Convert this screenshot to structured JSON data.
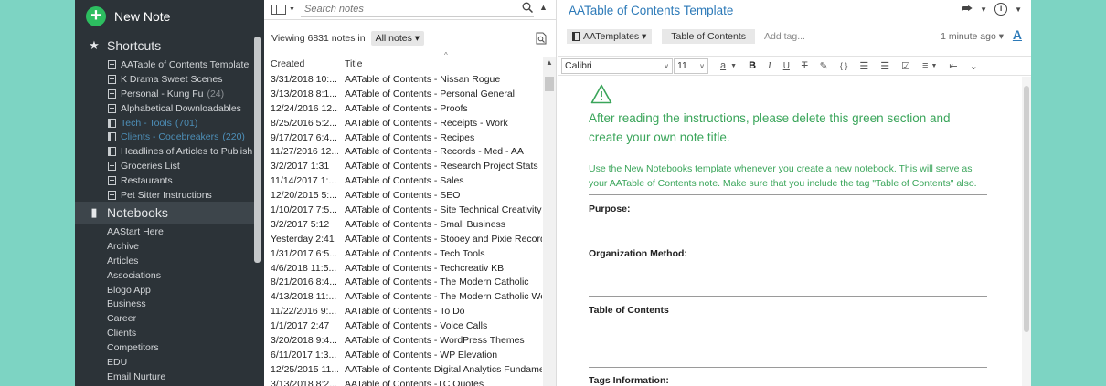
{
  "sidebar": {
    "new_note": "New Note",
    "shortcuts_label": "Shortcuts",
    "notebooks_label": "Notebooks",
    "shortcuts": [
      {
        "label": "AATable of Contents Template",
        "type": "note",
        "count": "",
        "dim": false
      },
      {
        "label": "K Drama Sweet Scenes",
        "type": "note",
        "count": "",
        "dim": false
      },
      {
        "label": "Personal - Kung Fu",
        "type": "note",
        "count": "(24)",
        "dim": false
      },
      {
        "label": "Alphabetical Downloadables",
        "type": "note",
        "count": "",
        "dim": false
      },
      {
        "label": "Tech - Tools",
        "type": "notebook",
        "count": "(701)",
        "dim": true
      },
      {
        "label": "Clients - Codebreakers",
        "type": "notebook",
        "count": "(220)",
        "dim": true
      },
      {
        "label": "Headlines of Articles to Publish",
        "type": "notebook",
        "count": "",
        "dim": false
      },
      {
        "label": "Groceries List",
        "type": "note",
        "count": "",
        "dim": false
      },
      {
        "label": "Restaurants",
        "type": "note",
        "count": "",
        "dim": false
      },
      {
        "label": "Pet Sitter Instructions",
        "type": "note",
        "count": "",
        "dim": false
      }
    ],
    "notebooks": [
      "AAStart Here",
      "Archive",
      "Articles",
      "Associations",
      "Blogo App",
      "Business",
      "Career",
      "Clients",
      "Competitors",
      "EDU",
      "Email Nurture"
    ]
  },
  "note_list": {
    "search_placeholder": "Search notes",
    "viewing_text": "Viewing 6831 notes in",
    "filter_label": "All notes ▾",
    "col_created": "Created",
    "col_title": "Title",
    "rows": [
      {
        "created": "3/31/2018 10:...",
        "title": "AATable of Contents - Nissan Rogue"
      },
      {
        "created": "3/13/2018 8:1...",
        "title": "AATable of Contents - Personal General"
      },
      {
        "created": "12/24/2016 12...",
        "title": "AATable of Contents - Proofs"
      },
      {
        "created": "8/25/2016 5:2...",
        "title": "AATable of Contents - Receipts - Work"
      },
      {
        "created": "9/17/2017 6:4...",
        "title": "AATable of Contents - Recipes"
      },
      {
        "created": "11/27/2016 12...",
        "title": "AATable of Contents - Records - Med - AA"
      },
      {
        "created": "3/2/2017 1:31",
        "title": "AATable of Contents - Research Project Stats"
      },
      {
        "created": "11/14/2017 1:...",
        "title": "AATable of Contents - Sales"
      },
      {
        "created": "12/20/2015 5:...",
        "title": "AATable of Contents - SEO"
      },
      {
        "created": "1/10/2017 7:5...",
        "title": "AATable of Contents - Site Technical Creativity"
      },
      {
        "created": "3/2/2017 5:12",
        "title": "AATable of Contents - Small Business"
      },
      {
        "created": "Yesterday 2:41",
        "title": "AATable of Contents - Stooey and Pixie Records"
      },
      {
        "created": "1/31/2017 6:5...",
        "title": "AATable of Contents - Tech Tools"
      },
      {
        "created": "4/6/2018 11:5...",
        "title": "AATable of Contents - Techcreativ KB"
      },
      {
        "created": "8/21/2016 8:4...",
        "title": "AATable of Contents - The Modern Catholic"
      },
      {
        "created": "4/13/2018 11:...",
        "title": "AATable of Contents - The Modern Catholic Web..."
      },
      {
        "created": "11/22/2016 9:...",
        "title": "AATable of Contents - To Do"
      },
      {
        "created": "1/1/2017 2:47",
        "title": "AATable of Contents - Voice Calls"
      },
      {
        "created": "3/20/2018 9:4...",
        "title": "AATable of Contents - WordPress Themes"
      },
      {
        "created": "6/11/2017 1:3...",
        "title": "AATable of Contents - WP Elevation"
      },
      {
        "created": "12/25/2015 11...",
        "title": "AATable of Contents Digital Analytics Fundamen..."
      },
      {
        "created": "3/13/2018 8:2...",
        "title": "AATable of Contents -TC Quotes"
      }
    ]
  },
  "editor": {
    "title": "AATable of Contents Template",
    "notebook": "AATemplates ▾",
    "tag": "Table of Contents",
    "add_tag": "Add tag...",
    "updated": "1 minute ago ▾",
    "font_name": "Calibri",
    "font_size": "11",
    "green_heading": "After reading the instructions, please delete this green section and create your own note title.",
    "green_text": "Use the New Notebooks template whenever you create a new notebook. This will serve as your AATable of Contents note. Make sure that you include the tag \"Table of Contents\" also.",
    "fields": {
      "purpose": "Purpose:",
      "organization": "Organization Method:",
      "toc": "Table of Contents",
      "tags": "Tags Information:"
    }
  },
  "colors": {
    "sidebar_bg": "#2c3338",
    "accent_green": "#2dbe60",
    "link_blue": "#2d7ab8",
    "instruction_green": "#3aa55a",
    "backdrop": "#7dd4c3"
  }
}
